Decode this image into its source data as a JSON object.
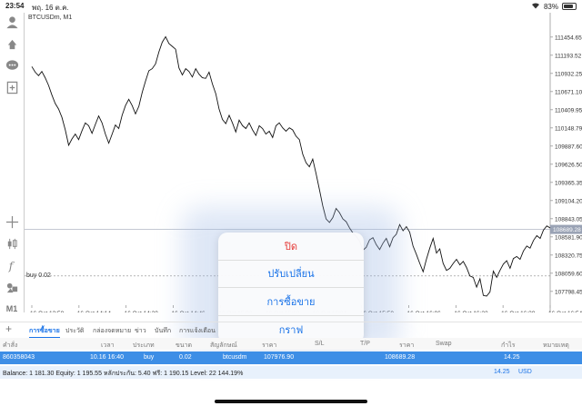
{
  "status_bar": {
    "time": "23:54",
    "date": "พฤ. 16 ต.ค.",
    "battery_text": "83%",
    "battery_level": 0.83
  },
  "chart": {
    "symbol_label": "BTCUSDm, M1",
    "buy_label": "buy 0.02",
    "price_tag": "108689.28"
  },
  "chart_data": {
    "type": "line",
    "ylim": [
      107600,
      111700
    ],
    "buy_level": 108020,
    "bid_level": 108689.28,
    "y_ticks": [
      "111454.65",
      "111193.52",
      "110932.25",
      "110671.10",
      "110409.95",
      "110148.79",
      "109887.60",
      "109626.50",
      "109365.35",
      "109104.20",
      "108843.05",
      "108581.90",
      "108320.75",
      "108059.60",
      "107798.45"
    ],
    "x_ticks": [
      "16 Oct 13:58",
      "16 Oct 14:14",
      "16 Oct 14:30",
      "16 Oct 14:46",
      "16 Oct 15:02",
      "16 Oct 15:18",
      "16 Oct 15:34",
      "16 Oct 15:50",
      "16 Oct 16:06",
      "16 Oct 16:22",
      "16 Oct 16:38",
      "16 Oct 16:54"
    ],
    "values": [
      111030,
      110950,
      110900,
      110960,
      110870,
      110760,
      110620,
      110500,
      110420,
      110300,
      110120,
      109900,
      109990,
      110060,
      109980,
      110110,
      110220,
      110180,
      110070,
      110200,
      110320,
      110220,
      110060,
      109930,
      110060,
      110190,
      110140,
      110330,
      110470,
      110560,
      110470,
      110350,
      110460,
      110660,
      110820,
      110970,
      111000,
      111070,
      111240,
      111380,
      111460,
      111360,
      111320,
      111280,
      111010,
      110910,
      111000,
      110960,
      110880,
      111000,
      110920,
      110870,
      110860,
      110950,
      110780,
      110640,
      110420,
      110270,
      110210,
      110330,
      110220,
      110090,
      110260,
      110180,
      110140,
      110220,
      110120,
      110040,
      110180,
      110140,
      110060,
      110100,
      110010,
      110180,
      110220,
      110150,
      110100,
      110150,
      110120,
      110030,
      109980,
      109770,
      109650,
      109590,
      109700,
      109490,
      109260,
      109030,
      108840,
      108790,
      108860,
      108990,
      108930,
      108840,
      108800,
      108710,
      108640,
      108590,
      108520,
      108390,
      108430,
      108540,
      108570,
      108470,
      108400,
      108490,
      108560,
      108440,
      108570,
      108620,
      108760,
      108670,
      108730,
      108650,
      108450,
      108330,
      108200,
      108080,
      108260,
      108420,
      108560,
      108350,
      108410,
      108200,
      108100,
      108130,
      108200,
      108260,
      108180,
      108230,
      108140,
      108020,
      108000,
      107860,
      107980,
      107740,
      107730,
      107790,
      108090,
      108000,
      108100,
      108190,
      108240,
      108130,
      108270,
      108300,
      108260,
      108380,
      108450,
      108420,
      108530,
      108600,
      108560,
      108680,
      108740,
      108710
    ]
  },
  "context_menu": {
    "items": [
      "ปิด",
      "ปรับเปลี่ยน",
      "การซื้อขาย",
      "กราฟ"
    ]
  },
  "tabs": {
    "items": [
      "การซื้อขาย",
      "ประวัติ",
      "กล่องจดหมาย",
      "ข่าว",
      "บันทึก",
      "การแจ้งเตือน"
    ]
  },
  "table": {
    "headers": [
      "คำสั่ง",
      "เวลา",
      "ประเภท",
      "ขนาด",
      "สัญลักษณ์",
      "ราคา",
      "S/L",
      "T/P",
      "ราคา",
      "Swap",
      "กำไร",
      "หมายเหตุ"
    ],
    "row": {
      "order": "860358043",
      "time": "10.16 16:40",
      "type": "buy",
      "size": "0.02",
      "symbol": "btcusdm",
      "open_price": "107976.90",
      "price": "108689.28",
      "profit": "14.25"
    },
    "summary": {
      "text": "Balance: 1 181.30 Equity: 1 195.55 หลักประกัน: 5.40 ฟรี: 1 190.15 Level: 22 144.19%",
      "profit": "14.25",
      "currency": "USD"
    }
  }
}
